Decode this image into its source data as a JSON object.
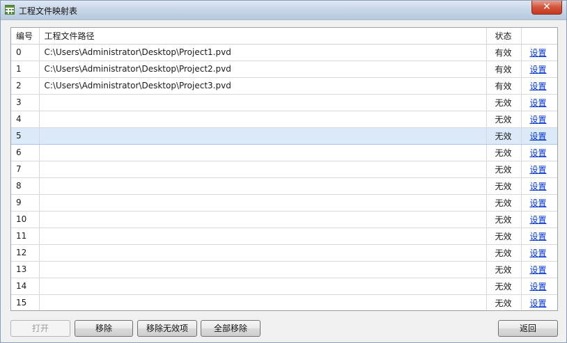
{
  "window": {
    "title": "工程文件映射表",
    "close_label": "✕"
  },
  "table": {
    "headers": {
      "index": "编号",
      "path": "工程文件路径",
      "status": "状态",
      "action": ""
    },
    "rows": [
      {
        "index": "0",
        "path": "C:\\Users\\Administrator\\Desktop\\Project1.pvd",
        "status": "有效",
        "action": "设置"
      },
      {
        "index": "1",
        "path": "C:\\Users\\Administrator\\Desktop\\Project2.pvd",
        "status": "有效",
        "action": "设置"
      },
      {
        "index": "2",
        "path": "C:\\Users\\Administrator\\Desktop\\Project3.pvd",
        "status": "有效",
        "action": "设置"
      },
      {
        "index": "3",
        "path": "",
        "status": "无效",
        "action": "设置"
      },
      {
        "index": "4",
        "path": "",
        "status": "无效",
        "action": "设置"
      },
      {
        "index": "5",
        "path": "",
        "status": "无效",
        "action": "设置"
      },
      {
        "index": "6",
        "path": "",
        "status": "无效",
        "action": "设置"
      },
      {
        "index": "7",
        "path": "",
        "status": "无效",
        "action": "设置"
      },
      {
        "index": "8",
        "path": "",
        "status": "无效",
        "action": "设置"
      },
      {
        "index": "9",
        "path": "",
        "status": "无效",
        "action": "设置"
      },
      {
        "index": "10",
        "path": "",
        "status": "无效",
        "action": "设置"
      },
      {
        "index": "11",
        "path": "",
        "status": "无效",
        "action": "设置"
      },
      {
        "index": "12",
        "path": "",
        "status": "无效",
        "action": "设置"
      },
      {
        "index": "13",
        "path": "",
        "status": "无效",
        "action": "设置"
      },
      {
        "index": "14",
        "path": "",
        "status": "无效",
        "action": "设置"
      },
      {
        "index": "15",
        "path": "",
        "status": "无效",
        "action": "设置"
      }
    ],
    "selected_index": "5"
  },
  "buttons": {
    "open": "打开",
    "remove": "移除",
    "remove_invalid": "移除无效项",
    "remove_all": "全部移除",
    "back": "返回"
  },
  "colors": {
    "selected_row": "#dce9f9",
    "link": "#0033cc",
    "close_button": "#c43b20"
  }
}
